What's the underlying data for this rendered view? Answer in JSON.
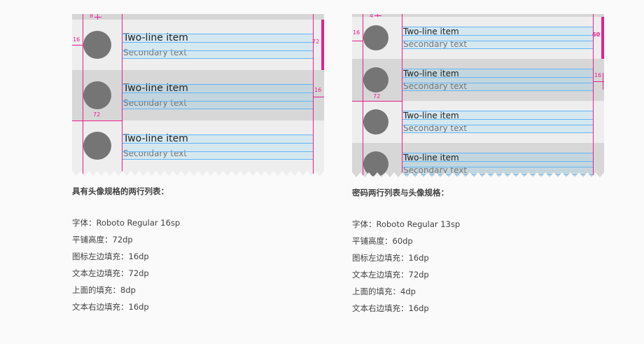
{
  "left_spec": {
    "caption": "具有头像规格的两行列表：",
    "items": [
      {
        "primary": "Two-line item",
        "secondary": "Secondary text"
      },
      {
        "primary": "Two-line item",
        "secondary": "Secondary text"
      },
      {
        "primary": "Two-line item",
        "secondary": "Secondary text"
      }
    ],
    "annotations": {
      "top": "8",
      "icon_left": "16",
      "row_height": "72",
      "text_left": "72",
      "right_pad": "16"
    },
    "specs": [
      "字体：Roboto Regular 16sp",
      "平铺高度：72dp",
      "图标左边填充：16dp",
      "文本左边填充：72dp",
      "上面的填充：8dp",
      "文本右边填充：16dp"
    ]
  },
  "right_spec": {
    "caption": "密码两行列表与头像规格：",
    "items": [
      {
        "primary": "Two-line item",
        "secondary": "Secondary text"
      },
      {
        "primary": "Two-line item",
        "secondary": "Secondary text"
      },
      {
        "primary": "Two-line item",
        "secondary": "Secondary text"
      },
      {
        "primary": "Two-line item",
        "secondary": "Secondary text"
      }
    ],
    "annotations": {
      "top": "4",
      "icon_left": "16",
      "row_height": "60",
      "text_left": "72",
      "right_pad": "16"
    },
    "specs": [
      "字体：Roboto Regular 13sp",
      "平铺高度：60dp",
      "图标左边填充：16dp",
      "文本左边填充：72dp",
      "上面的填充：4dp",
      "文本右边填充：16dp"
    ]
  },
  "colors": {
    "accent": "#e91e8c",
    "keyline": "#64b5f6",
    "avatar": "#757575"
  }
}
